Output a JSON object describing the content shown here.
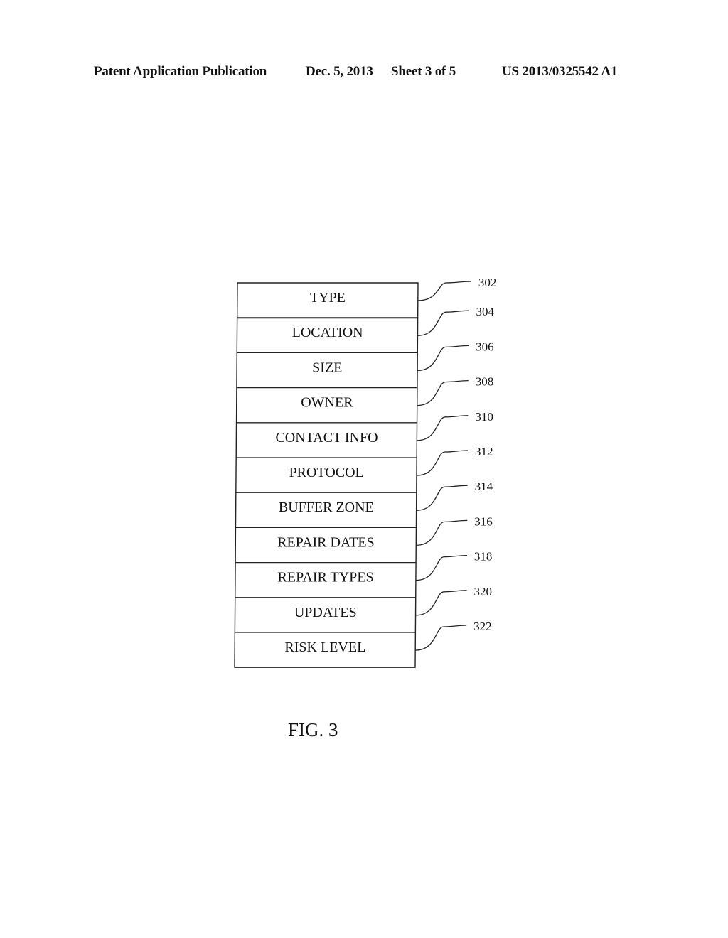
{
  "header": {
    "publication_type": "Patent Application Publication",
    "date": "Dec. 5, 2013",
    "sheet": "Sheet 3 of 5",
    "publication_number": "US 2013/0325542 A1"
  },
  "figure": {
    "label": "FIG. 3",
    "fields": [
      {
        "text": "TYPE",
        "ref": "302"
      },
      {
        "text": "LOCATION",
        "ref": "304"
      },
      {
        "text": "SIZE",
        "ref": "306"
      },
      {
        "text": "OWNER",
        "ref": "308"
      },
      {
        "text": "CONTACT INFO",
        "ref": "310"
      },
      {
        "text": "PROTOCOL",
        "ref": "312"
      },
      {
        "text": "BUFFER ZONE",
        "ref": "314"
      },
      {
        "text": "REPAIR DATES",
        "ref": "316"
      },
      {
        "text": "REPAIR TYPES",
        "ref": "318"
      },
      {
        "text": "UPDATES",
        "ref": "320"
      },
      {
        "text": "RISK LEVEL",
        "ref": "322"
      }
    ]
  }
}
